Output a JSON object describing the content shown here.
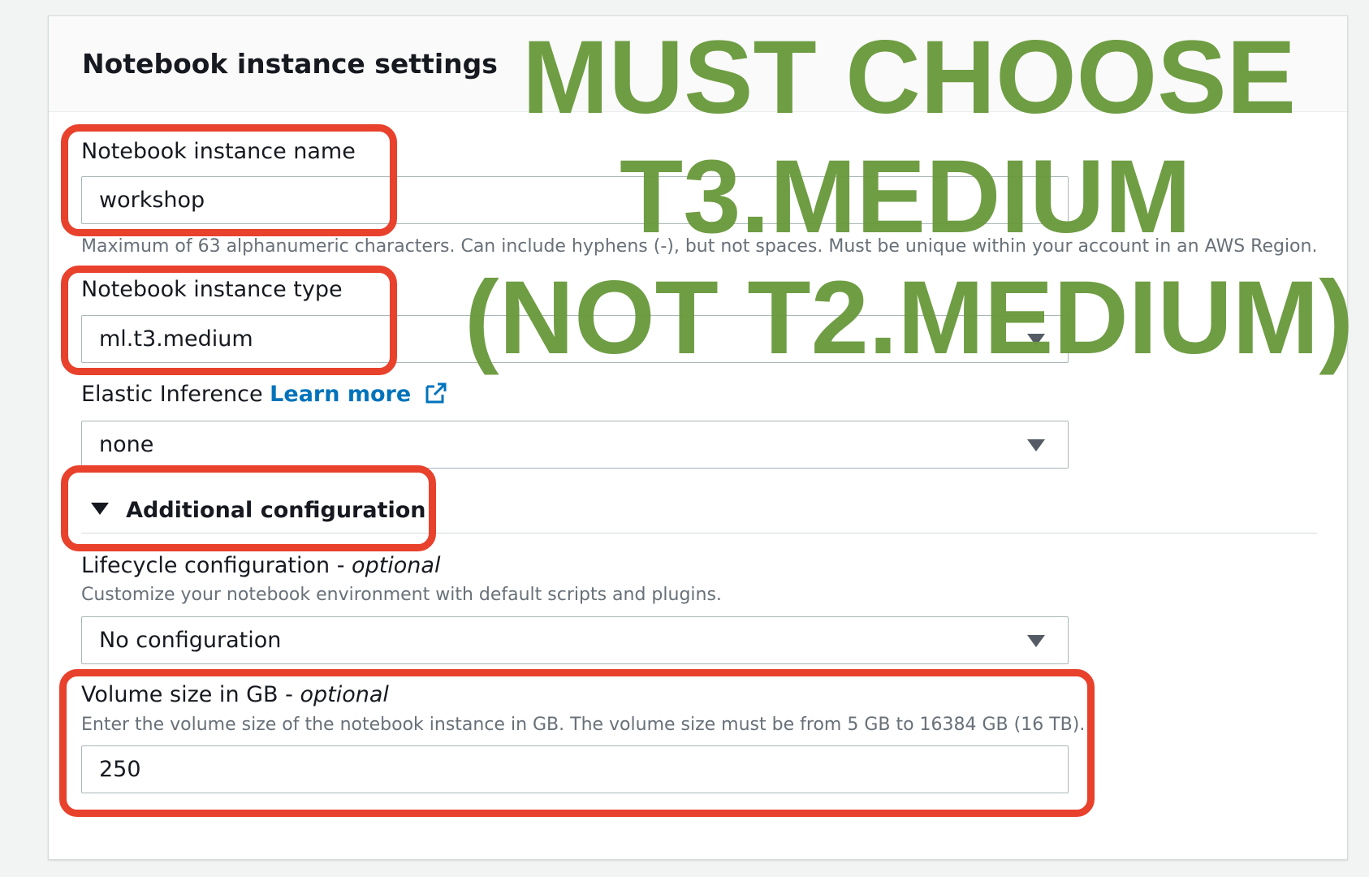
{
  "panel": {
    "title": "Notebook instance settings"
  },
  "fields": {
    "instance_name": {
      "label": "Notebook instance name",
      "value": "workshop",
      "hint": "Maximum of 63 alphanumeric characters. Can include hyphens (-), but not spaces. Must be unique within your account in an AWS Region."
    },
    "instance_type": {
      "label": "Notebook instance type",
      "value": "ml.t3.medium",
      "icon": "chevron-down-icon"
    },
    "elastic_inference": {
      "label": "Elastic Inference",
      "link_text": "Learn more",
      "link_icon": "external-link-icon",
      "value": "none",
      "icon": "chevron-down-icon"
    },
    "additional_configuration": {
      "label": "Additional configuration",
      "expanded": true,
      "icon": "triangle-down-icon"
    },
    "lifecycle": {
      "label": "Lifecycle configuration",
      "optional": "optional",
      "hint": "Customize your notebook environment with default scripts and plugins.",
      "value": "No configuration",
      "icon": "chevron-down-icon"
    },
    "volume_size": {
      "label": "Volume size in GB",
      "optional": "optional",
      "hint": "Enter the volume size of the notebook instance in GB. The volume size must be from 5 GB to 16384 GB (16 TB).",
      "value": "250"
    }
  },
  "annotation": {
    "line1": "MUST CHOOSE",
    "line2": "T3.MEDIUM",
    "line3": "(NOT T2.MEDIUM)",
    "text_color": "#6b9a3e",
    "highlight_color": "#e8412c"
  },
  "colors": {
    "link": "#0073bb",
    "hint": "#687078",
    "border": "#aab7b8"
  }
}
